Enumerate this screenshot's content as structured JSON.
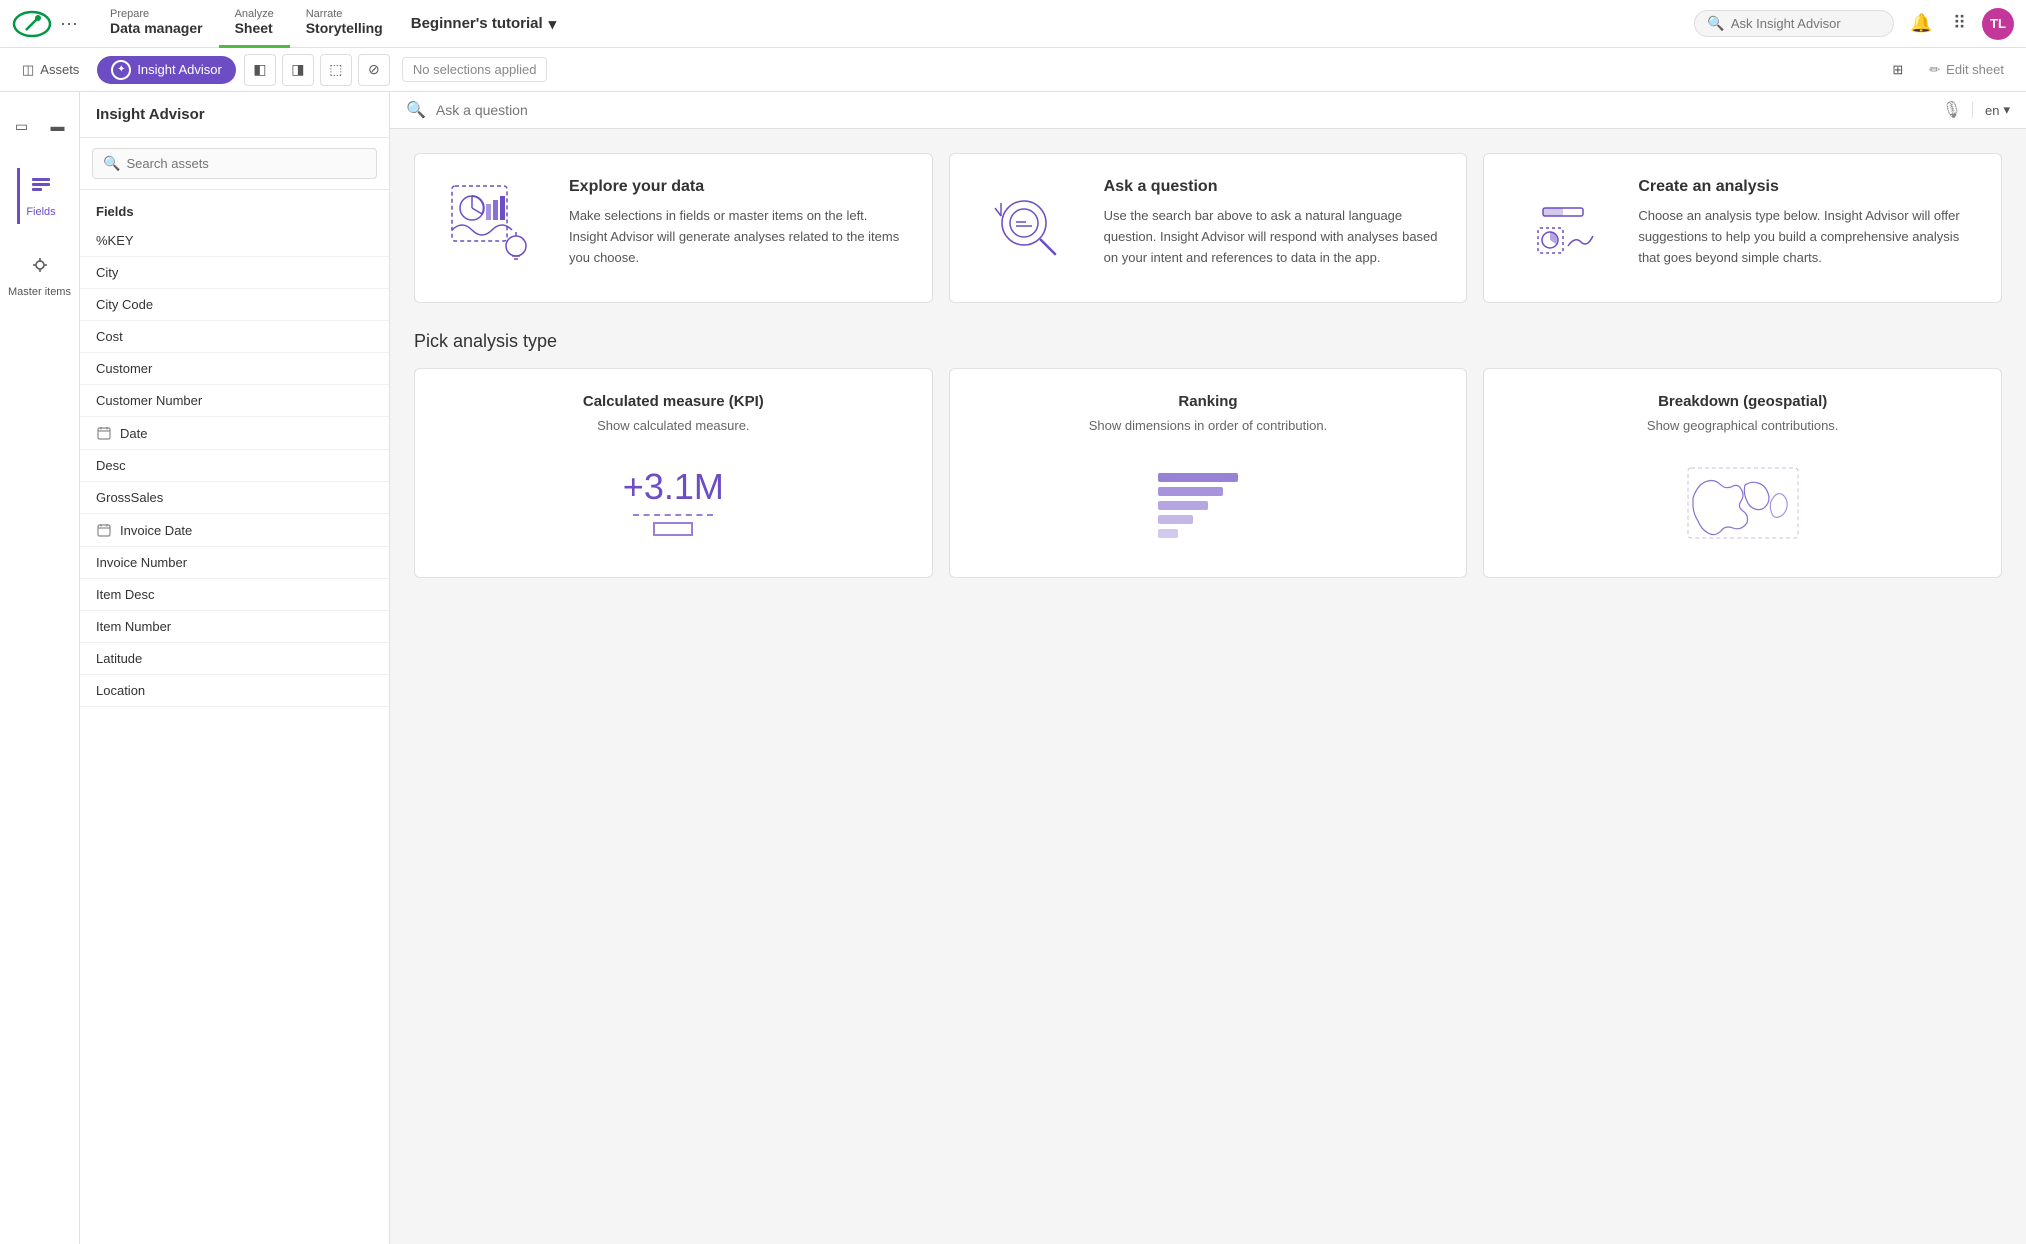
{
  "app_title": "Beginner's tutorial",
  "nav": {
    "prepare_label_top": "Prepare",
    "prepare_label": "Data manager",
    "analyze_label_top": "Analyze",
    "analyze_label": "Sheet",
    "narrate_label_top": "Narrate",
    "narrate_label": "Storytelling",
    "ask_insight": "Ask Insight Advisor",
    "dots": "···"
  },
  "toolbar2": {
    "assets": "Assets",
    "insight_advisor": "Insight Advisor",
    "no_selections": "No selections applied",
    "edit_sheet": "Edit sheet"
  },
  "sidebar": {
    "fields_label": "Fields",
    "master_items_label": "Master items"
  },
  "insight_panel": {
    "title": "Insight Advisor",
    "search_placeholder": "Search assets",
    "fields_header": "Fields"
  },
  "fields": [
    {
      "name": "%KEY",
      "icon": ""
    },
    {
      "name": "City",
      "icon": ""
    },
    {
      "name": "City Code",
      "icon": ""
    },
    {
      "name": "Cost",
      "icon": ""
    },
    {
      "name": "Customer",
      "icon": ""
    },
    {
      "name": "Customer Number",
      "icon": ""
    },
    {
      "name": "Date",
      "icon": "calendar"
    },
    {
      "name": "Desc",
      "icon": ""
    },
    {
      "name": "GrossSales",
      "icon": ""
    },
    {
      "name": "Invoice Date",
      "icon": "calendar"
    },
    {
      "name": "Invoice Number",
      "icon": ""
    },
    {
      "name": "Item Desc",
      "icon": ""
    },
    {
      "name": "Item Number",
      "icon": ""
    },
    {
      "name": "Latitude",
      "icon": ""
    },
    {
      "name": "Location",
      "icon": ""
    }
  ],
  "question_bar": {
    "placeholder": "Ask a question",
    "lang": "en"
  },
  "info_cards": [
    {
      "title": "Explore your data",
      "desc": "Make selections in fields or master items on the left. Insight Advisor will generate analyses related to the items you choose."
    },
    {
      "title": "Ask a question",
      "desc": "Use the search bar above to ask a natural language question. Insight Advisor will respond with analyses based on your intent and references to data in the app."
    },
    {
      "title": "Create an analysis",
      "desc": "Choose an analysis type below. Insight Advisor will offer suggestions to help you build a comprehensive analysis that goes beyond simple charts."
    }
  ],
  "analysis_section": {
    "title": "Pick analysis type"
  },
  "analysis_cards": [
    {
      "title": "Calculated measure (KPI)",
      "desc": "Show calculated measure.",
      "visual_type": "kpi"
    },
    {
      "title": "Ranking",
      "desc": "Show dimensions in order of contribution.",
      "visual_type": "ranking"
    },
    {
      "title": "Breakdown (geospatial)",
      "desc": "Show geographical contributions.",
      "visual_type": "geo"
    }
  ],
  "colors": {
    "accent": "#6c4dc4",
    "accent_light": "#9b7fd4",
    "green": "#52b848",
    "pink": "#c4379a"
  },
  "avatar": "TL",
  "lang_value": "en"
}
